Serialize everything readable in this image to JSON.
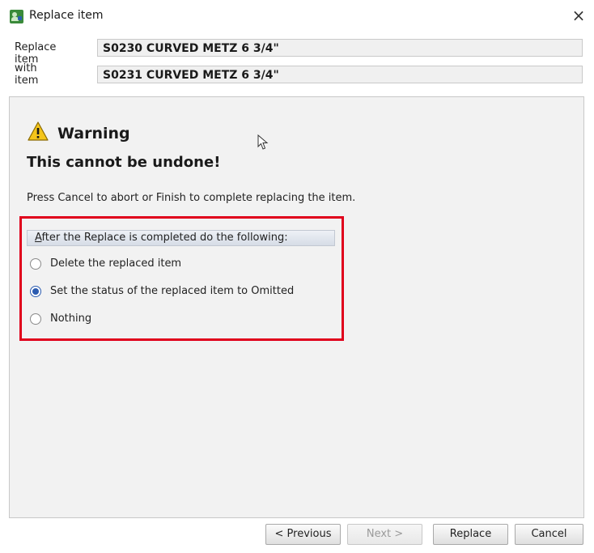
{
  "window": {
    "title": "Replace item",
    "close_symbol": "×",
    "icon": "app-icon"
  },
  "header": {
    "replace_label": "Replace item",
    "replace_value": "S0230 CURVED METZ 6 3/4\"",
    "with_label": "with item",
    "with_value": "S0231 CURVED METZ 6 3/4\""
  },
  "warning": {
    "icon": "warning-icon",
    "title": "Warning",
    "subtitle": "This cannot be undone!",
    "instruction": "Press Cancel to abort or Finish to complete replacing the item."
  },
  "options": {
    "header_prefix": "A",
    "header_rest": "fter the Replace is completed do the following:",
    "items": [
      {
        "label": "Delete the replaced item",
        "selected": false
      },
      {
        "label": "Set the status of the replaced item to Omitted",
        "selected": true
      },
      {
        "label": "Nothing",
        "selected": false
      }
    ],
    "highlight_color": "#e0001b"
  },
  "buttons": {
    "previous": "< Previous",
    "next": "Next >",
    "replace": "Replace",
    "cancel": "Cancel"
  }
}
